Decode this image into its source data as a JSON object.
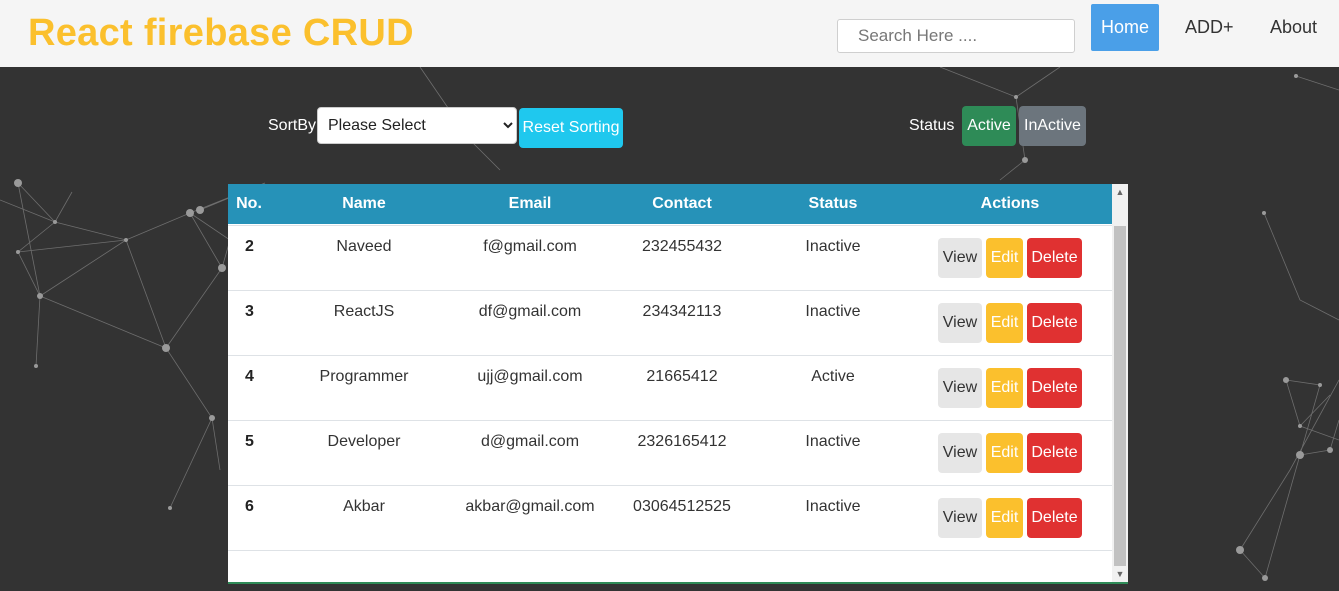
{
  "navbar": {
    "brand": "React firebase CRUD",
    "search_placeholder": "Search Here ....",
    "links": {
      "home": "Home",
      "add": "ADD+",
      "about": "About"
    }
  },
  "controls": {
    "sort_label": "SortBy:",
    "sort_selected": "Please Select",
    "reset_label": "Reset Sorting",
    "status_label": "Status",
    "active_label": "Active",
    "inactive_label": "InActive"
  },
  "table": {
    "headers": {
      "no": "No.",
      "name": "Name",
      "email": "Email",
      "contact": "Contact",
      "status": "Status",
      "actions": "Actions"
    },
    "actions": {
      "view": "View",
      "edit": "Edit",
      "delete": "Delete"
    },
    "rows": [
      {
        "no": "",
        "name": "",
        "email": "",
        "contact": "",
        "status": ""
      },
      {
        "no": "2",
        "name": "Naveed",
        "email": "f@gmail.com",
        "contact": "232455432",
        "status": "Inactive"
      },
      {
        "no": "3",
        "name": "ReactJS",
        "email": "df@gmail.com",
        "contact": "234342113",
        "status": "Inactive"
      },
      {
        "no": "4",
        "name": "Programmer",
        "email": "ujj@gmail.com",
        "contact": "21665412",
        "status": "Active"
      },
      {
        "no": "5",
        "name": "Developer",
        "email": "d@gmail.com",
        "contact": "2326165412",
        "status": "Inactive"
      },
      {
        "no": "6",
        "name": "Akbar",
        "email": "akbar@gmail.com",
        "contact": "03064512525",
        "status": "Inactive"
      }
    ]
  },
  "colors": {
    "brand": "#fbc02d",
    "home_active": "#4a9fe8",
    "table_header": "#2692b8",
    "active_button": "#2e8b57",
    "inactive_button": "#6c757d",
    "reset_button": "#1fc8ee",
    "edit_button": "#fbc02d",
    "delete_button": "#e03131"
  }
}
